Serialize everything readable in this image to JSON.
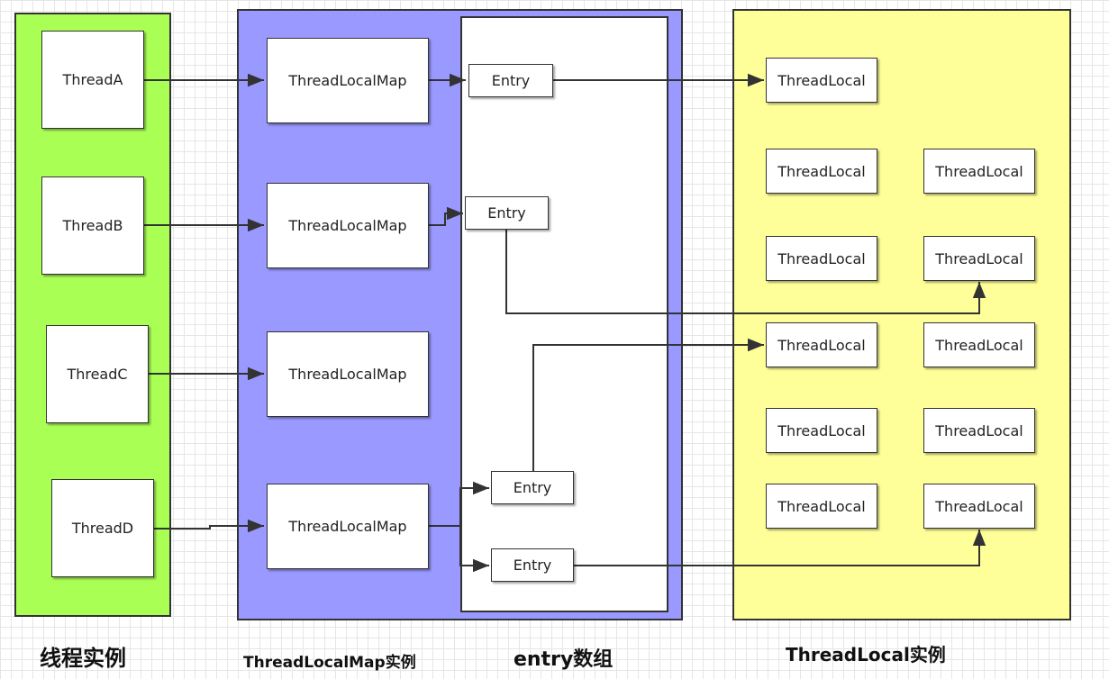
{
  "colors": {
    "thread_panel": "#aaff55",
    "map_panel": "#9999ff",
    "entry_panel": "#ffffff",
    "threadlocal_panel": "#ffff99",
    "line": "#333333"
  },
  "labels": {
    "threads": "线程实例",
    "maps": "ThreadLocalMap实例",
    "entries": "entry数组",
    "threadlocals": "ThreadLocal实例"
  },
  "threads": [
    "ThreadA",
    "ThreadB",
    "ThreadC",
    "ThreadD"
  ],
  "maps": [
    "ThreadLocalMap",
    "ThreadLocalMap",
    "ThreadLocalMap",
    "ThreadLocalMap"
  ],
  "entries": [
    "Entry",
    "Entry",
    "Entry",
    "Entry"
  ],
  "threadlocals": [
    "ThreadLocal",
    "ThreadLocal",
    "ThreadLocal",
    "ThreadLocal",
    "ThreadLocal",
    "ThreadLocal",
    "ThreadLocal",
    "ThreadLocal",
    "ThreadLocal",
    "ThreadLocal",
    "ThreadLocal"
  ]
}
